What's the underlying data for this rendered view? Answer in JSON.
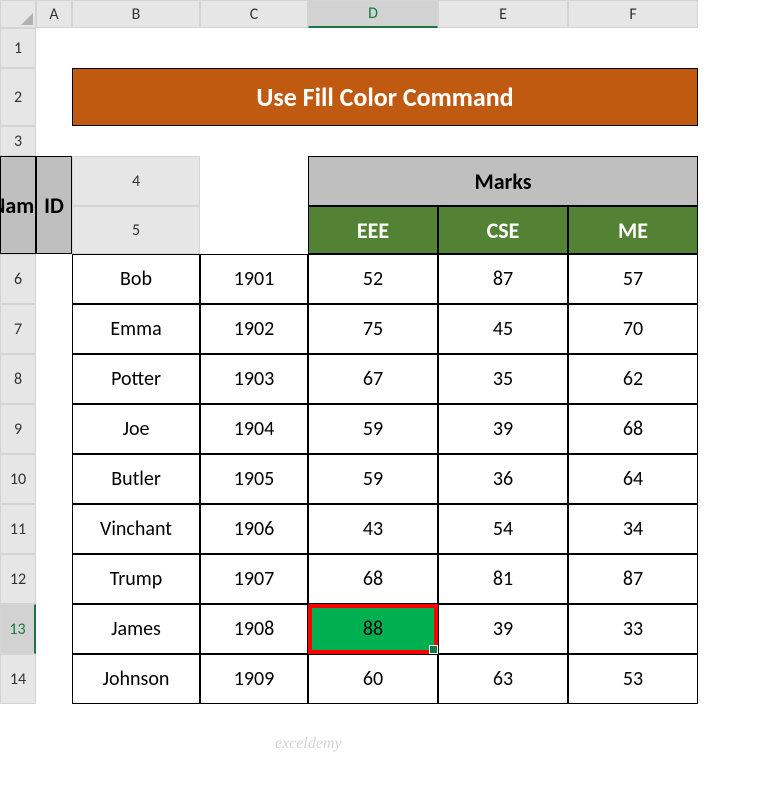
{
  "columns": [
    "A",
    "B",
    "C",
    "D",
    "E",
    "F"
  ],
  "rows": [
    "1",
    "2",
    "3",
    "4",
    "5",
    "6",
    "7",
    "8",
    "9",
    "10",
    "11",
    "12",
    "13",
    "14"
  ],
  "active_col": "D",
  "active_row": "13",
  "title": "Use Fill Color Command",
  "headers": {
    "name": "Name",
    "id": "ID",
    "marks": "Marks",
    "sub1": "EEE",
    "sub2": "CSE",
    "sub3": "ME"
  },
  "data": [
    {
      "name": "Bob",
      "id": "1901",
      "eee": "52",
      "cse": "87",
      "me": "57"
    },
    {
      "name": "Emma",
      "id": "1902",
      "eee": "75",
      "cse": "45",
      "me": "70"
    },
    {
      "name": "Potter",
      "id": "1903",
      "eee": "67",
      "cse": "35",
      "me": "62"
    },
    {
      "name": "Joe",
      "id": "1904",
      "eee": "59",
      "cse": "39",
      "me": "68"
    },
    {
      "name": "Butler",
      "id": "1905",
      "eee": "59",
      "cse": "36",
      "me": "64"
    },
    {
      "name": "Vinchant",
      "id": "1906",
      "eee": "43",
      "cse": "54",
      "me": "34"
    },
    {
      "name": "Trump",
      "id": "1907",
      "eee": "68",
      "cse": "81",
      "me": "87"
    },
    {
      "name": "James",
      "id": "1908",
      "eee": "88",
      "cse": "39",
      "me": "33"
    },
    {
      "name": "Johnson",
      "id": "1909",
      "eee": "60",
      "cse": "63",
      "me": "53"
    }
  ],
  "watermark": "exceldemy"
}
